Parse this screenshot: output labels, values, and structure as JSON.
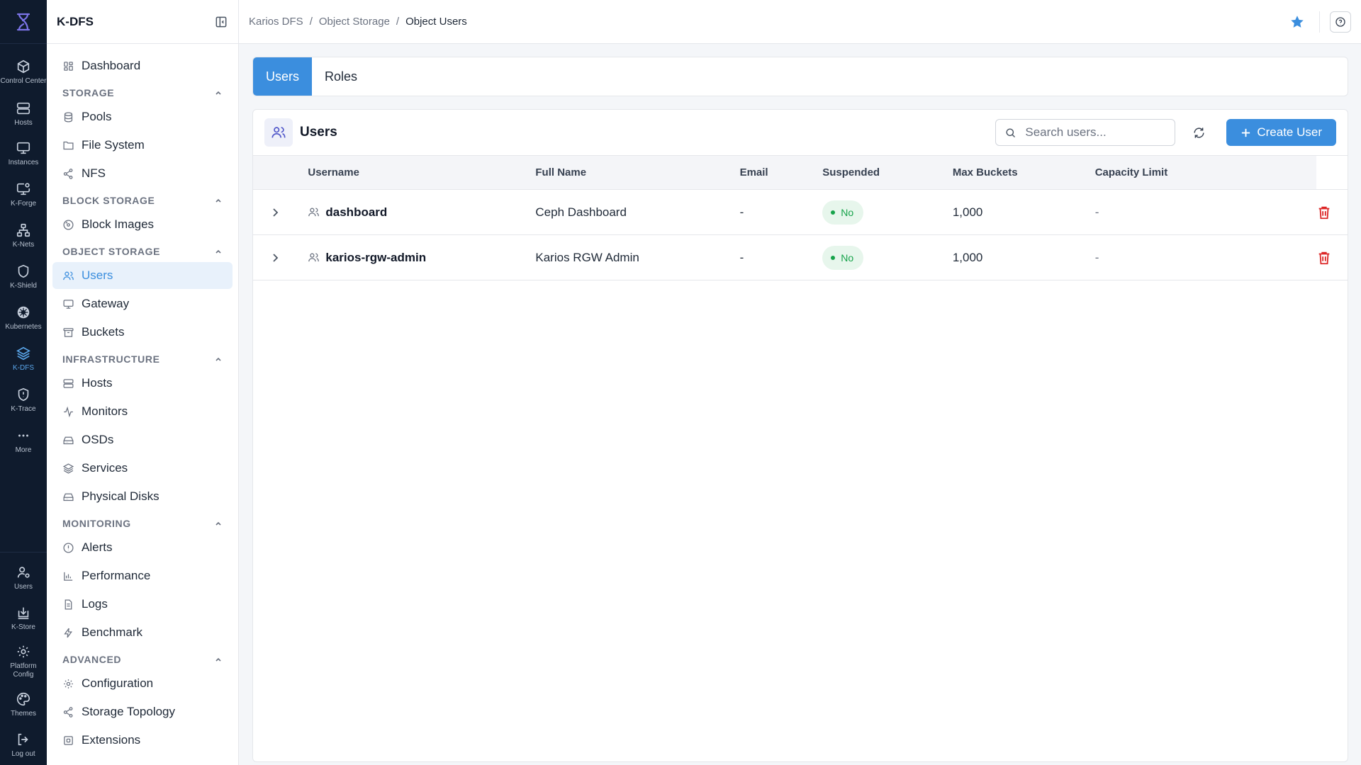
{
  "rail": {
    "items": [
      {
        "label": "Control Center",
        "icon": "box-icon"
      },
      {
        "label": "Hosts",
        "icon": "server-icon"
      },
      {
        "label": "Instances",
        "icon": "monitor-icon"
      },
      {
        "label": "K-Forge",
        "icon": "monitor-gear-icon"
      },
      {
        "label": "K-Nets",
        "icon": "network-icon"
      },
      {
        "label": "K-Shield",
        "icon": "shield-icon"
      },
      {
        "label": "Kubernetes",
        "icon": "helm-icon"
      },
      {
        "label": "K-DFS",
        "icon": "layers-icon"
      },
      {
        "label": "K-Trace",
        "icon": "shield-alert-icon"
      },
      {
        "label": "More",
        "icon": "more-icon"
      }
    ],
    "bottom": [
      {
        "label": "Users",
        "icon": "users-gear-icon"
      },
      {
        "label": "K-Store",
        "icon": "download-box-icon"
      },
      {
        "label": "Platform Config",
        "icon": "gear-icon"
      },
      {
        "label": "Themes",
        "icon": "palette-icon"
      },
      {
        "label": "Log out",
        "icon": "logout-icon"
      }
    ]
  },
  "sidebar": {
    "title": "K-DFS",
    "dashboard": "Dashboard",
    "sections": {
      "storage": {
        "title": "STORAGE",
        "items": [
          "Pools",
          "File System",
          "NFS"
        ]
      },
      "block": {
        "title": "BLOCK STORAGE",
        "items": [
          "Block Images"
        ]
      },
      "object": {
        "title": "OBJECT STORAGE",
        "items": [
          "Users",
          "Gateway",
          "Buckets"
        ]
      },
      "infra": {
        "title": "INFRASTRUCTURE",
        "items": [
          "Hosts",
          "Monitors",
          "OSDs",
          "Services",
          "Physical Disks"
        ]
      },
      "monitoring": {
        "title": "MONITORING",
        "items": [
          "Alerts",
          "Performance",
          "Logs",
          "Benchmark"
        ]
      },
      "advanced": {
        "title": "ADVANCED",
        "items": [
          "Configuration",
          "Storage Topology",
          "Extensions"
        ]
      }
    }
  },
  "breadcrumb": [
    "Karios DFS",
    "Object Storage",
    "Object Users"
  ],
  "tabs": [
    "Users",
    "Roles"
  ],
  "card": {
    "title": "Users",
    "search_placeholder": "Search users...",
    "create_label": "Create User"
  },
  "table": {
    "columns": [
      "Username",
      "Full Name",
      "Email",
      "Suspended",
      "Max Buckets",
      "Capacity Limit"
    ],
    "rows": [
      {
        "username": "dashboard",
        "full_name": "Ceph Dashboard",
        "email": "-",
        "suspended": "No",
        "max_buckets": "1,000",
        "capacity": "-"
      },
      {
        "username": "karios-rgw-admin",
        "full_name": "Karios RGW Admin",
        "email": "-",
        "suspended": "No",
        "max_buckets": "1,000",
        "capacity": "-"
      }
    ]
  },
  "colors": {
    "accent": "#3b8ede",
    "rail_bg": "#0f1b2d",
    "success": "#16a34a",
    "danger": "#dc2626"
  }
}
